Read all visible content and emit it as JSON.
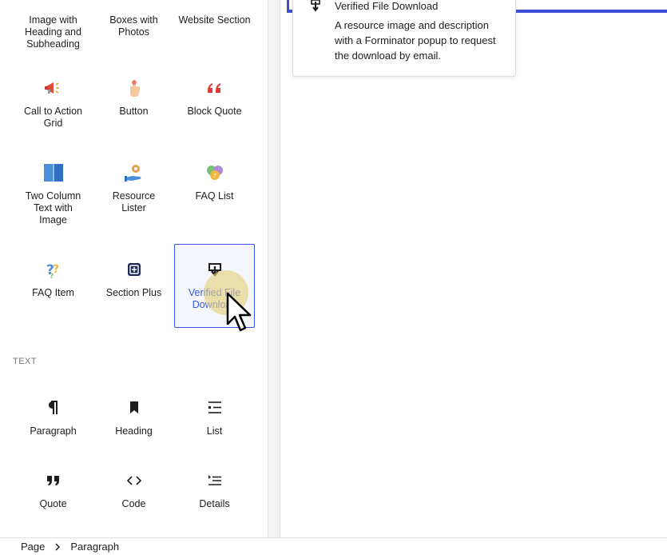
{
  "inserter": {
    "top_row": [
      {
        "label": "Image with Heading and Subheading"
      },
      {
        "label": "Boxes with Photos"
      },
      {
        "label": "Website Section"
      }
    ],
    "custom_blocks": [
      {
        "label": "Call to Action Grid",
        "icon": "megaphone-icon"
      },
      {
        "label": "Button",
        "icon": "pointing-hand-icon"
      },
      {
        "label": "Block Quote",
        "icon": "quote-marks-icon"
      },
      {
        "label": "Two Column Text with Image",
        "icon": "two-columns-icon"
      },
      {
        "label": "Resource Lister",
        "icon": "hand-resources-icon"
      },
      {
        "label": "FAQ List",
        "icon": "faq-bubbles-icon"
      },
      {
        "label": "FAQ Item",
        "icon": "question-marks-icon"
      },
      {
        "label": "Section Plus",
        "icon": "section-plus-icon"
      },
      {
        "label": "Verified File Download",
        "icon": "download-icon"
      }
    ],
    "text_section": {
      "title": "TEXT",
      "blocks": [
        {
          "label": "Paragraph",
          "icon": "pilcrow-icon"
        },
        {
          "label": "Heading",
          "icon": "bookmark-icon"
        },
        {
          "label": "List",
          "icon": "list-icon"
        },
        {
          "label": "Quote",
          "icon": "quote-icon"
        },
        {
          "label": "Code",
          "icon": "code-icon"
        },
        {
          "label": "Details",
          "icon": "details-icon"
        }
      ]
    }
  },
  "tooltip": {
    "title": "Verified File Download",
    "description": "A resource image and description with a Forminator popup to request the download by email."
  },
  "breadcrumb": {
    "items": [
      "Page",
      "Paragraph"
    ]
  },
  "colors": {
    "accent": "#3858e9",
    "canvas_line": "#3d4fd6",
    "cursor_halo": "#e4ce78"
  }
}
